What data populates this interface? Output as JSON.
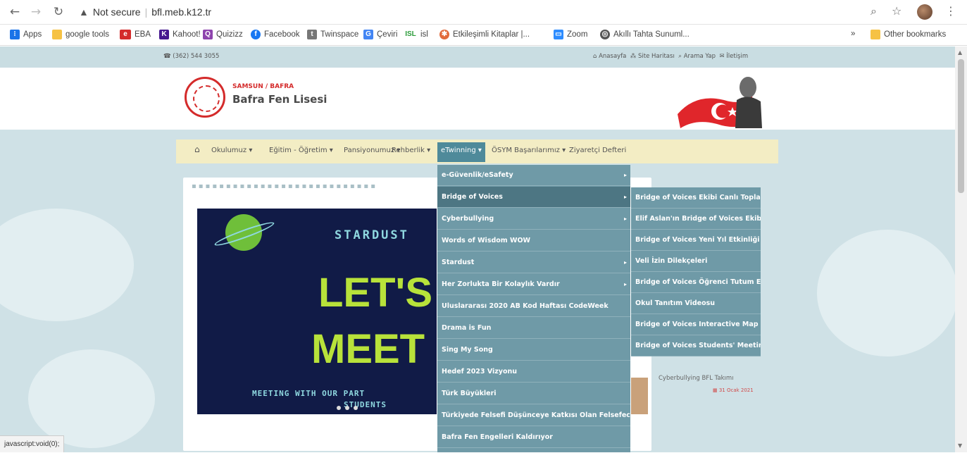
{
  "browser": {
    "security_label": "Not secure",
    "url": "bfl.meb.k12.tr",
    "status_text": "javascript:void(0);"
  },
  "bookmarks": {
    "apps": "Apps",
    "items": [
      "google tools",
      "EBA",
      "Kahoot!",
      "Quizizz",
      "Facebook",
      "Twinspace",
      "Çeviri",
      "isl",
      "Etkileşimli Kitaplar |...",
      "Zoom",
      "Akıllı Tahta Sunuml..."
    ],
    "overflow": "»",
    "other": "Other bookmarks"
  },
  "site": {
    "phone": "(362) 544 3055",
    "top_links": [
      "Anasayfa",
      "Site Haritası",
      "Arama Yap",
      "İletişim"
    ],
    "city": "SAMSUN / BAFRA",
    "school_name": "Bafra Fen Lisesi"
  },
  "nav": {
    "items": [
      "Okulumuz",
      "Eğitim - Öğretim",
      "Pansiyonumuz",
      "Rehberlik",
      "eTwinning",
      "ÖSYM Başarılarımız",
      "Ziyaretçi Defteri"
    ],
    "active": "eTwinning"
  },
  "slide": {
    "stardust": "STARDUST",
    "lets": "LET'S",
    "meet": "MEET",
    "meeting_with": "MEETING WITH OUR PART",
    "students": "STUDENTS"
  },
  "news": {
    "title": "Cyberbullying BFL Takımı",
    "date": "31 Ocak 2021"
  },
  "dropdown": {
    "items": [
      {
        "label": "e-Güvenlik/eSafety",
        "has_sub": true
      },
      {
        "label": "Bridge of Voices",
        "has_sub": true
      },
      {
        "label": "Cyberbullying",
        "has_sub": true
      },
      {
        "label": "Words of Wisdom WOW",
        "has_sub": false
      },
      {
        "label": "Stardust",
        "has_sub": true
      },
      {
        "label": "Her Zorlukta Bir Kolaylık Vardır",
        "has_sub": true
      },
      {
        "label": "Uluslararası 2020 AB Kod Haftası CodeWeek",
        "has_sub": false
      },
      {
        "label": "Drama is Fun",
        "has_sub": false
      },
      {
        "label": "Sing My Song",
        "has_sub": false
      },
      {
        "label": "Hedef 2023 Vizyonu",
        "has_sub": false
      },
      {
        "label": "Türk Büyükleri",
        "has_sub": false
      },
      {
        "label": "Türkiyede Felsefi Düşünceye Katkısı Olan Felsefeciler",
        "has_sub": false
      },
      {
        "label": "Bafra Fen Engelleri Kaldırıyor",
        "has_sub": false
      }
    ],
    "highlighted": "Bridge of Voices"
  },
  "submenu": {
    "items": [
      "Bridge of Voices Ekibi Canlı Toplantısı",
      "Elif Aslan'ın Bridge of Voices Ekibi",
      "Bridge of Voices Yeni Yıl Etkinliği",
      "Veli İzin Dilekçeleri",
      "Bridge of Voices Öğrenci Tutum Etkinliği",
      "Okul Tanıtım Videosu",
      "Bridge of Voices Interactive Map",
      "Bridge of Voices Students' Meeting"
    ]
  },
  "colors": {
    "menu_bg": "#6f9aa7",
    "menu_highlight": "#4d7683",
    "nav_bg": "#f3edc4",
    "brand_red": "#d42b2b"
  }
}
